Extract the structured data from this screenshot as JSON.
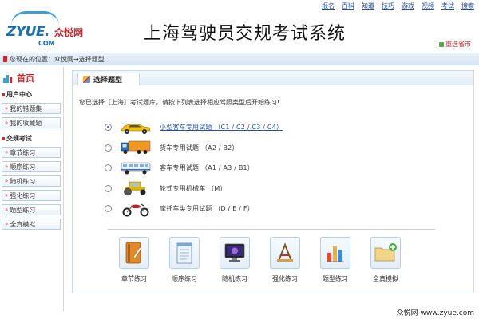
{
  "header": {
    "logo_brand": "ZYUE.",
    "logo_cn": "众悦网",
    "logo_domain": "COM",
    "site_title": "上海驾驶员交规考试系统",
    "city_button": "重选省市",
    "topnav": [
      "报名",
      "百科",
      "知道",
      "技巧",
      "游戏",
      "视频",
      "考试",
      "搜索"
    ]
  },
  "breadcrumb": {
    "text": "您现在的位置：众悦网→选择题型"
  },
  "sidebar": {
    "home_label": "首页",
    "user_center": "用户中心",
    "user_items": [
      "我的错题集",
      "我的收藏题"
    ],
    "exam_center": "交规考试",
    "exam_items": [
      "章节练习",
      "顺序练习",
      "随机练习",
      "强化练习",
      "题型练习",
      "全真模拟"
    ]
  },
  "main": {
    "tab_label": "选择题型",
    "intro": "您已选择［上海］考试题库，请按下列表选择相应驾照类型后开始练习!",
    "options": [
      {
        "label": "小型客车专用试题 （C1 / C2 / C3 / C4）",
        "vehicle": "car-icon",
        "selected": true
      },
      {
        "label": "货车专用试题 （A2 / B2）",
        "vehicle": "truck-icon",
        "selected": false
      },
      {
        "label": "客车专用试题 （A1 / A3 / B1）",
        "vehicle": "bus-icon",
        "selected": false
      },
      {
        "label": "轮式专用机械车 （M）",
        "vehicle": "roller-icon",
        "selected": false
      },
      {
        "label": "摩托车类专用试题 （D / E / F）",
        "vehicle": "motorcycle-icon",
        "selected": false
      }
    ],
    "tools": [
      {
        "label": "章节练习",
        "icon": "book-icon"
      },
      {
        "label": "顺序练习",
        "icon": "notepad-icon"
      },
      {
        "label": "随机练习",
        "icon": "monitor-icon"
      },
      {
        "label": "强化练习",
        "icon": "tools-icon"
      },
      {
        "label": "题型练习",
        "icon": "bar-chart-icon"
      },
      {
        "label": "全真模拟",
        "icon": "folder-add-icon"
      }
    ]
  },
  "watermark": "众悦网 www.zyue.com",
  "colors": {
    "accent_red": "#c8292e",
    "link_blue": "#2450a0",
    "border_blue": "#b7cde3"
  }
}
